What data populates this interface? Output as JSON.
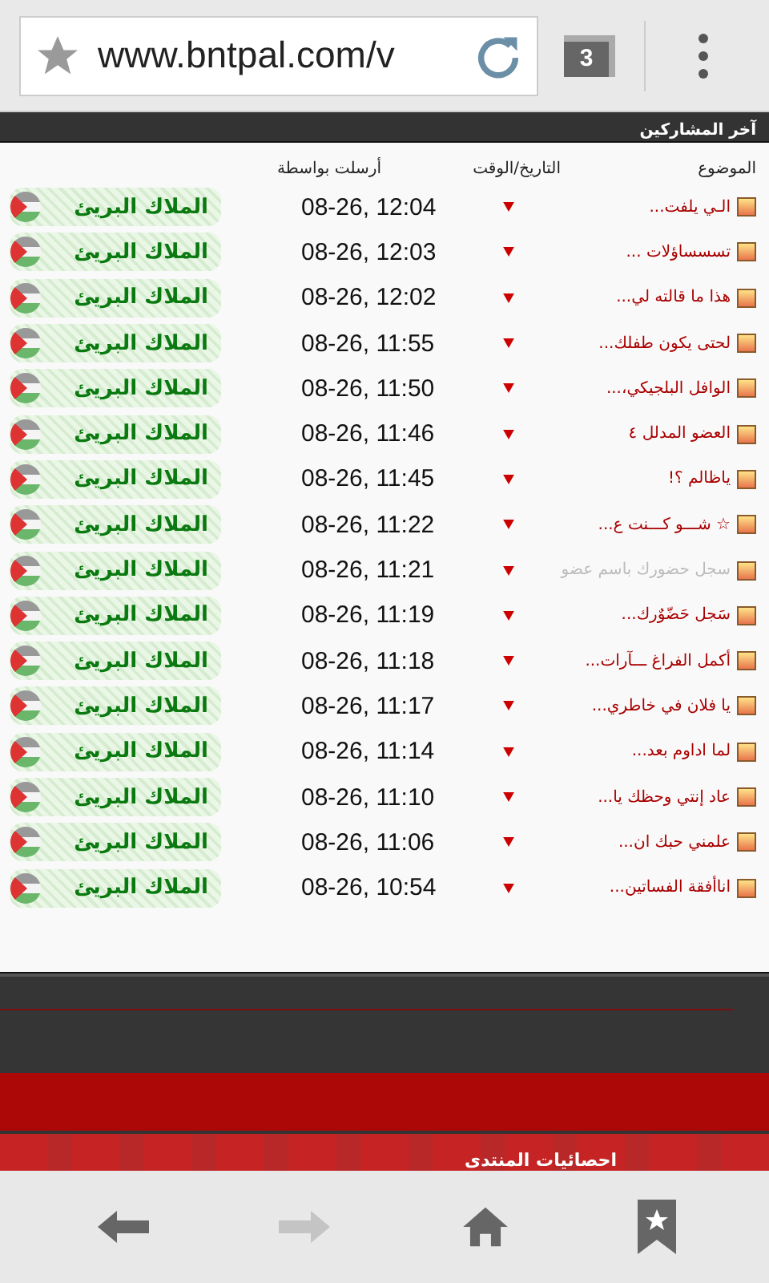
{
  "browser": {
    "url": "www.bntpal.com/v",
    "tab_count": "3"
  },
  "section": {
    "title": "آخر المشاركين"
  },
  "table": {
    "columns": [
      "الموضوع",
      "التاريخ/الوقت",
      "أرسلت بواسطة"
    ],
    "rows": [
      {
        "topic": "الـي يلفت...",
        "greyed": false,
        "date": "08-26, 12:04",
        "author": "الملاك البريئ"
      },
      {
        "topic": "تسسساؤلات ...",
        "greyed": false,
        "date": "08-26, 12:03",
        "author": "الملاك البريئ"
      },
      {
        "topic": "هذا ما قالته لي...",
        "greyed": false,
        "date": "08-26, 12:02",
        "author": "الملاك البريئ"
      },
      {
        "topic": "لحتى يكون طفلك...",
        "greyed": false,
        "date": "08-26, 11:55",
        "author": "الملاك البريئ"
      },
      {
        "topic": "الوافل البلجيكي،...",
        "greyed": false,
        "date": "08-26, 11:50",
        "author": "الملاك البريئ"
      },
      {
        "topic": "العضو المدلل ٤",
        "greyed": false,
        "date": "08-26, 11:46",
        "author": "الملاك البريئ"
      },
      {
        "topic": "ياظالم ؟!",
        "greyed": false,
        "date": "08-26, 11:45",
        "author": "الملاك البريئ"
      },
      {
        "topic": "☆ شـــو كـــنت ع...",
        "greyed": false,
        "date": "08-26, 11:22",
        "author": "الملاك البريئ"
      },
      {
        "topic": "سجل حضورك باسم عضو",
        "greyed": true,
        "date": "08-26, 11:21",
        "author": "الملاك البريئ"
      },
      {
        "topic": "سَجل حَضّوٌرك...",
        "greyed": false,
        "date": "08-26, 11:19",
        "author": "الملاك البريئ"
      },
      {
        "topic": "أكمل الفراغ ـــآرات...",
        "greyed": false,
        "date": "08-26, 11:18",
        "author": "الملاك البريئ"
      },
      {
        "topic": "يا فلان في خاطري...",
        "greyed": false,
        "date": "08-26, 11:17",
        "author": "الملاك البريئ"
      },
      {
        "topic": "لما اداوم بعد...",
        "greyed": false,
        "date": "08-26, 11:14",
        "author": "الملاك البريئ"
      },
      {
        "topic": "عاد إنتي وحظك يا...",
        "greyed": false,
        "date": "08-26, 11:10",
        "author": "الملاك البريئ"
      },
      {
        "topic": "علمني حبك ان...",
        "greyed": false,
        "date": "08-26, 11:06",
        "author": "الملاك البريئ"
      },
      {
        "topic": "اناأفقة الفساتين...",
        "greyed": false,
        "date": "08-26, 10:54",
        "author": "الملاك البريئ"
      }
    ]
  },
  "stats_bar": {
    "title": "احصائيات المنتدى"
  },
  "nav": {
    "forward_disabled": true
  }
}
